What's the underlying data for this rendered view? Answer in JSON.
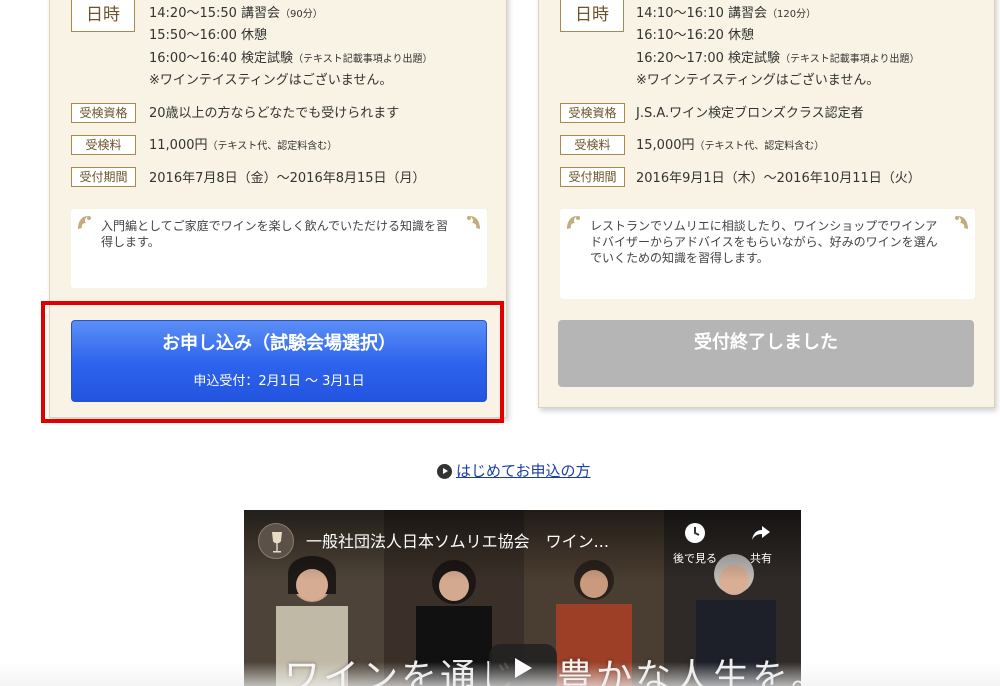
{
  "left_course": {
    "schedule_tag": "日時",
    "schedule": [
      {
        "text": "14:20〜15:50 講習会",
        "note": "（90分）"
      },
      {
        "text": "15:50〜16:00 休憩",
        "note": ""
      },
      {
        "text": "16:00〜16:40 検定試験",
        "note": "（テキスト記載事項より出題）"
      },
      {
        "text": "※ワインテイスティングはございません。",
        "note": ""
      }
    ],
    "qualification_tag": "受検資格",
    "qualification": "20歳以上の方ならどなたでも受けられます",
    "fee_tag": "受検料",
    "fee": "11,000円",
    "fee_note": "（テキスト代、認定料含む）",
    "period_tag": "受付期間",
    "period": "2016年7月8日（金）〜2016年8月15日（月）",
    "description": "入門編としてご家庭でワインを楽しく飲んでいただける知識を習得します。",
    "apply_button": "お申し込み（試験会場選択）",
    "apply_period": "申込受付：2月1日 〜 3月1日"
  },
  "right_course": {
    "schedule_tag": "日時",
    "schedule": [
      {
        "text": "14:10〜16:10 講習会",
        "note": "（120分）"
      },
      {
        "text": "16:10〜16:20 休憩",
        "note": ""
      },
      {
        "text": "16:20〜17:00 検定試験",
        "note": "（テキスト記載事項より出題）"
      },
      {
        "text": "※ワインテイスティングはございません。",
        "note": ""
      }
    ],
    "qualification_tag": "受検資格",
    "qualification": "J.S.A.ワイン検定ブロンズクラス認定者",
    "fee_tag": "受検料",
    "fee": "15,000円",
    "fee_note": "（テキスト代、認定料含む）",
    "period_tag": "受付期間",
    "period": "2016年9月1日（木）〜2016年10月11日（火）",
    "description": "レストランでソムリエに相談したり、ワインショップでワインアドバイザーからアドバイスをもらいながら、好みのワインを選んでいくための知識を習得します。",
    "closed_button": "受付終了しました"
  },
  "first_time_link": "はじめてお申込の方",
  "video": {
    "title": "一般社団法人日本ソムリエ協会　ワイン...",
    "watch_later": "後で見る",
    "share": "共有",
    "caption": "ワインを通じ　豊かな人生を。"
  },
  "colors": {
    "card_bg": "#f8f3e4",
    "tag_border": "#a88a4e",
    "apply_blue": "#2c63ec",
    "closed_gray": "#b5b5b5",
    "highlight_red": "#e00000",
    "link_blue": "#1a3ea3"
  }
}
